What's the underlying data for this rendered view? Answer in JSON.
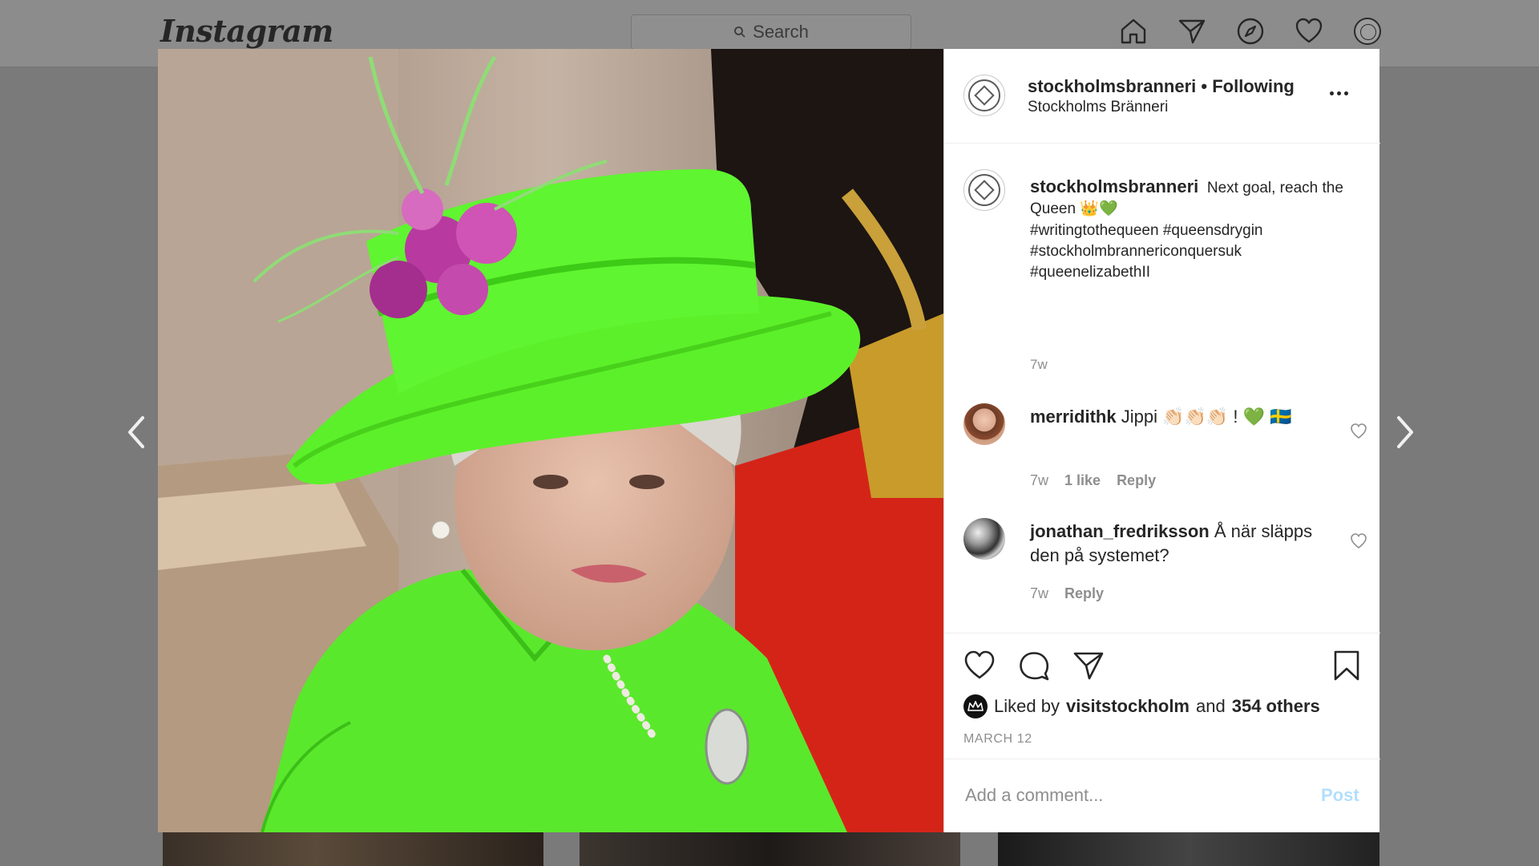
{
  "app": {
    "logo_text": "Instagram"
  },
  "nav": {
    "search_placeholder": "Search",
    "icons": [
      "home-icon",
      "direct-icon",
      "explore-icon",
      "activity-heart-icon",
      "profile-avatar"
    ]
  },
  "post": {
    "header": {
      "username_line": "stockholmsbranneri • Following",
      "location": "Stockholms Bränneri"
    },
    "caption": {
      "username": "stockholmsbranneri",
      "text": "Next goal, reach the Queen 👑💚",
      "hashtags": "#writingtothequeen #queensdrygin #stockholmbrannericonquersuk #queenelizabethII",
      "time": "7w"
    },
    "comments": [
      {
        "username": "merridithk",
        "text": "Jippi 👏🏻👏🏻👏🏻 ! 💚 🇸🇪",
        "time": "7w",
        "likes": "1 like",
        "reply_label": "Reply"
      },
      {
        "username": "jonathan_fredriksson",
        "text": "Å när släpps den på systemet?",
        "time": "7w",
        "reply_label": "Reply"
      }
    ],
    "likes": {
      "prefix": "Liked by",
      "by_user": "visitstockholm",
      "conjunction": "and",
      "others": "354 others"
    },
    "date": "MARCH 12",
    "add_comment": {
      "placeholder": "Add a comment...",
      "post_label": "Post"
    }
  },
  "colors": {
    "overlay_bg": "#7a7a7a",
    "text": "#262626",
    "muted": "#8e8e8e",
    "post_button_disabled": "#b2dffc",
    "hat_green": "#5cf02a"
  }
}
